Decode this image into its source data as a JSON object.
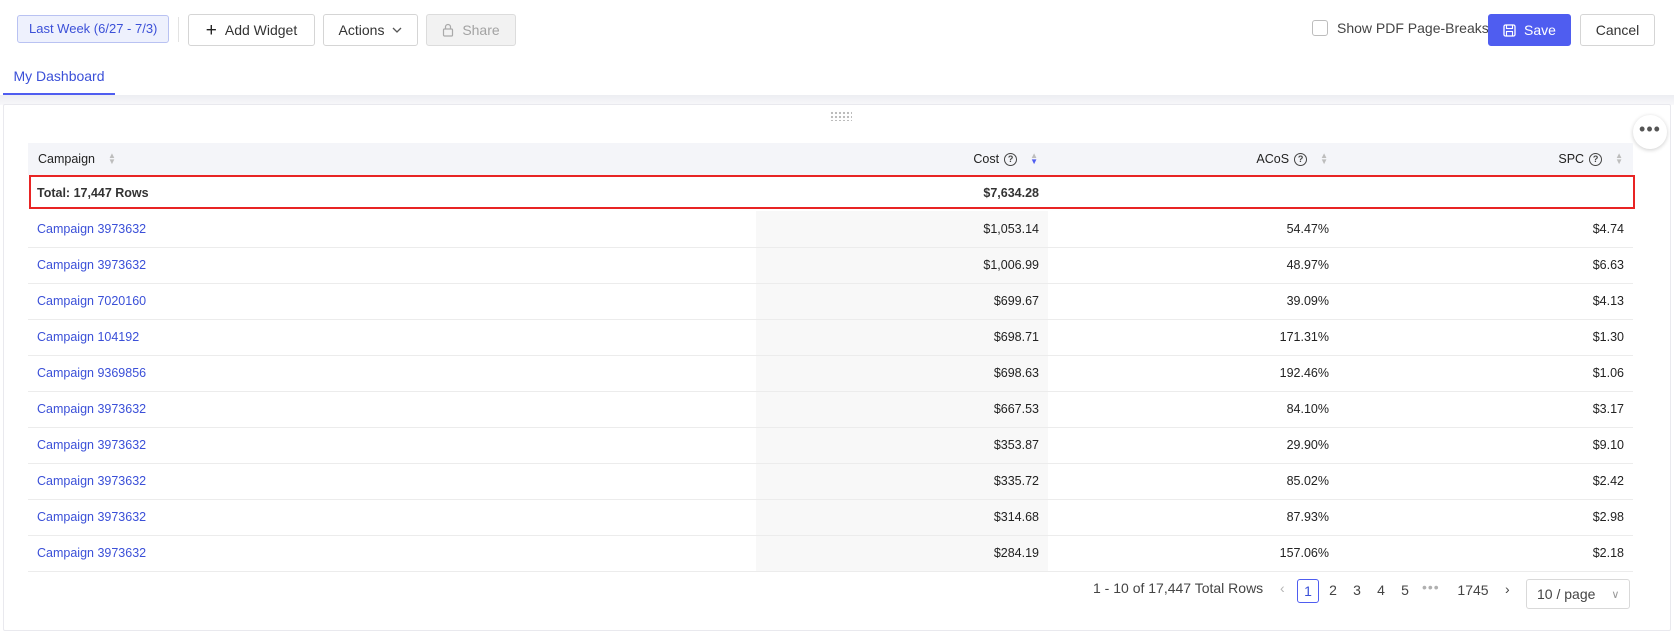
{
  "toolbar": {
    "date_range": "Last Week (6/27 - 7/3)",
    "add_widget": "Add Widget",
    "actions": "Actions",
    "share": "Share",
    "pdf_breaks_label": "Show PDF Page-Breaks",
    "save": "Save",
    "cancel": "Cancel"
  },
  "tabs": [
    {
      "label": "My Dashboard",
      "active": true
    }
  ],
  "table": {
    "columns": [
      "Campaign",
      "Cost",
      "ACoS",
      "SPC"
    ],
    "sorted_column": "Cost",
    "total": {
      "label": "Total: 17,447 Rows",
      "cost": "$7,634.28",
      "acos": "",
      "spc": ""
    },
    "rows": [
      {
        "campaign": "Campaign 3973632",
        "cost": "$1,053.14",
        "acos": "54.47%",
        "spc": "$4.74"
      },
      {
        "campaign": "Campaign 3973632",
        "cost": "$1,006.99",
        "acos": "48.97%",
        "spc": "$6.63"
      },
      {
        "campaign": "Campaign 7020160",
        "cost": "$699.67",
        "acos": "39.09%",
        "spc": "$4.13"
      },
      {
        "campaign": "Campaign 104192",
        "cost": "$698.71",
        "acos": "171.31%",
        "spc": "$1.30"
      },
      {
        "campaign": "Campaign 9369856",
        "cost": "$698.63",
        "acos": "192.46%",
        "spc": "$1.06"
      },
      {
        "campaign": "Campaign 3973632",
        "cost": "$667.53",
        "acos": "84.10%",
        "spc": "$3.17"
      },
      {
        "campaign": "Campaign 3973632",
        "cost": "$353.87",
        "acos": "29.90%",
        "spc": "$9.10"
      },
      {
        "campaign": "Campaign 3973632",
        "cost": "$335.72",
        "acos": "85.02%",
        "spc": "$2.42"
      },
      {
        "campaign": "Campaign 3973632",
        "cost": "$314.68",
        "acos": "87.93%",
        "spc": "$2.98"
      },
      {
        "campaign": "Campaign 3973632",
        "cost": "$284.19",
        "acos": "157.06%",
        "spc": "$2.18"
      }
    ]
  },
  "pagination": {
    "summary": "1 - 10 of 17,447 Total Rows",
    "pages": [
      "1",
      "2",
      "3",
      "4",
      "5"
    ],
    "last_page": "1745",
    "current_page": "1",
    "page_size": "10 / page"
  },
  "colors": {
    "accent": "#4f5df0",
    "link": "#3b50d8",
    "highlight_border": "#e82424"
  },
  "icons": {
    "more": "more-horizontal-icon",
    "drag": "drag-handle-icon"
  }
}
